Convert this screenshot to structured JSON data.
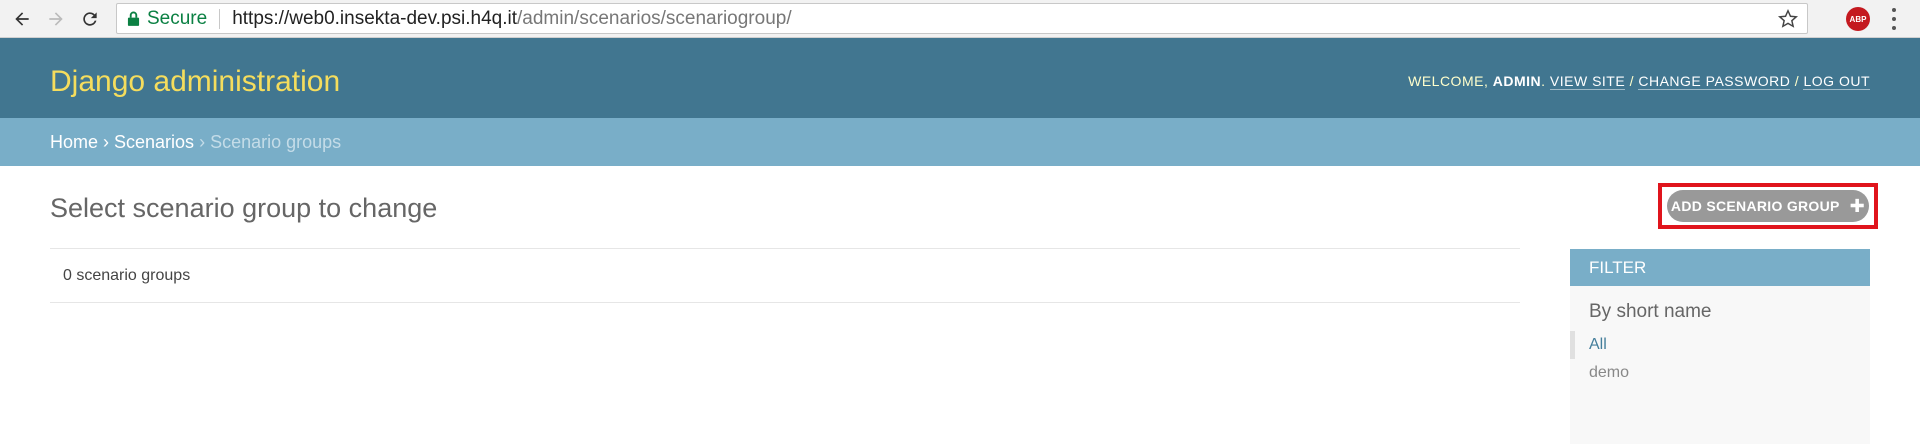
{
  "browser": {
    "secure_label": "Secure",
    "url_host": "https://web0.insekta-dev.psi.h4q.it",
    "url_path": "/admin/scenarios/scenariogroup/",
    "extension_label": "ABP"
  },
  "header": {
    "branding": "Django administration",
    "welcome": "Welcome,",
    "username": "admin",
    "view_site": "View site",
    "change_password": "Change password",
    "log_out": "Log out"
  },
  "breadcrumbs": {
    "home": "Home",
    "app": "Scenarios",
    "current": "Scenario groups",
    "separator": "›"
  },
  "content": {
    "title": "Select scenario group to change",
    "add_button": "Add scenario group",
    "result_count": "0 scenario groups"
  },
  "filter": {
    "title": "Filter",
    "subtitle": "By short name",
    "options": [
      "All",
      "demo"
    ]
  }
}
